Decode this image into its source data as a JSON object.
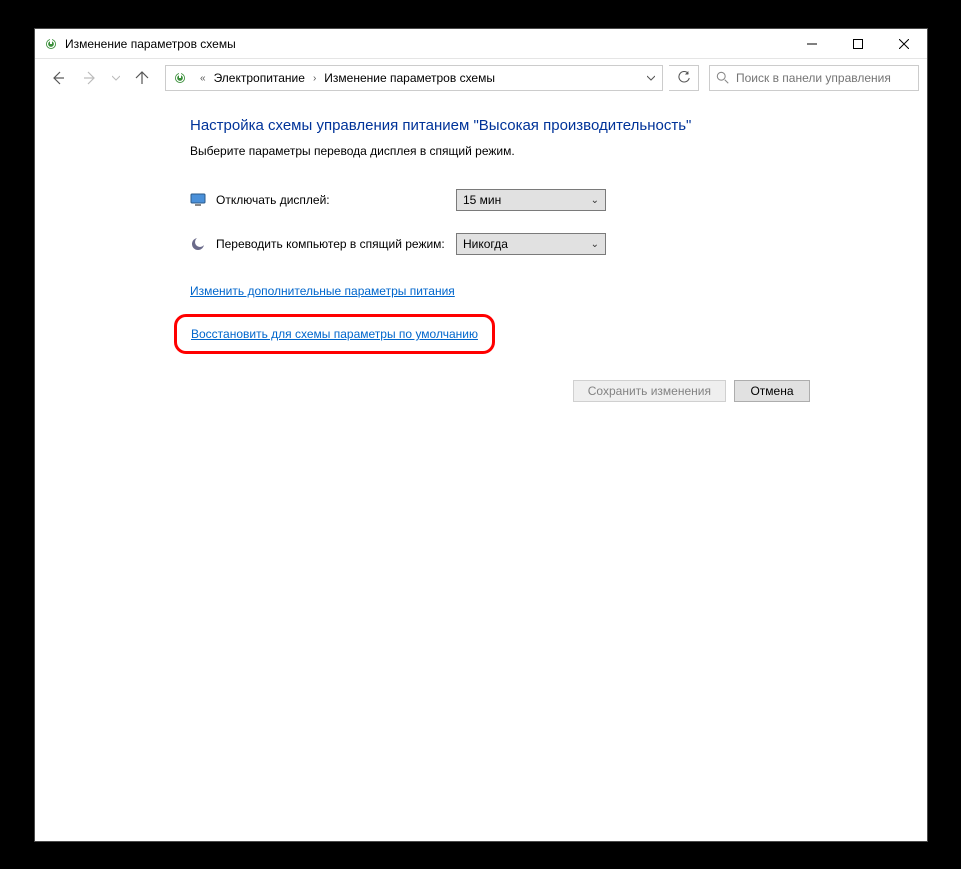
{
  "window": {
    "title": "Изменение параметров схемы"
  },
  "nav": {
    "crumb1": "Электропитание",
    "crumb2": "Изменение параметров схемы",
    "search_placeholder": "Поиск в панели управления"
  },
  "page": {
    "title": "Настройка схемы управления питанием \"Высокая производительность\"",
    "subtitle": "Выберите параметры перевода дисплея в спящий режим."
  },
  "settings": {
    "display_off_label": "Отключать дисплей:",
    "display_off_value": "15 мин",
    "sleep_label": "Переводить компьютер в спящий режим:",
    "sleep_value": "Никогда"
  },
  "links": {
    "advanced": "Изменить дополнительные параметры питания",
    "restore": "Восстановить для схемы параметры по умолчанию"
  },
  "buttons": {
    "save": "Сохранить изменения",
    "cancel": "Отмена"
  }
}
